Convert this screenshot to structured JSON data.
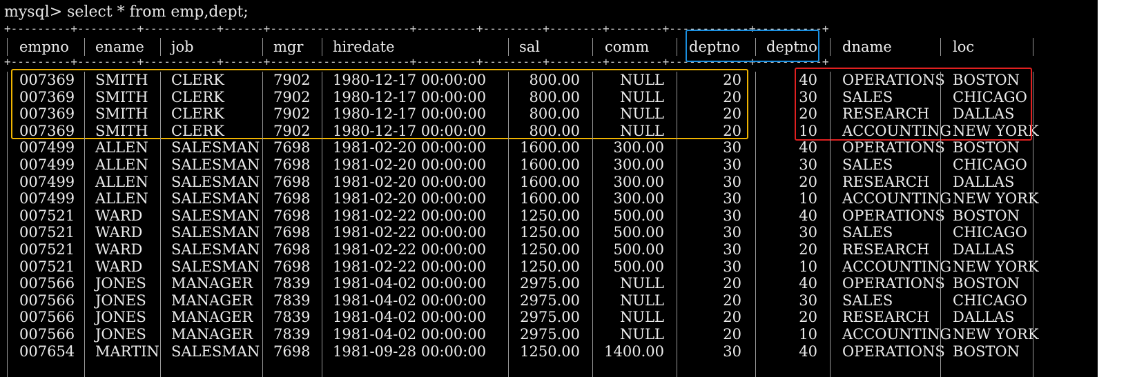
{
  "terminal": {
    "command_line": "mysql> select * from emp,dept;",
    "separator_line": "+---------+---------+-----------+------+---------------------+---------+---------+--------+--------+------------+----------+"
  },
  "table": {
    "columns": [
      "empno",
      "ename",
      "job",
      "mgr",
      "hiredate",
      "sal",
      "comm",
      "deptno",
      "deptno",
      "dname",
      "loc"
    ],
    "rows": [
      [
        "007369",
        "SMITH",
        "CLERK",
        "7902",
        "1980-12-17 00:00:00",
        "800.00",
        "NULL",
        "20",
        "40",
        "OPERATIONS",
        "BOSTON"
      ],
      [
        "007369",
        "SMITH",
        "CLERK",
        "7902",
        "1980-12-17 00:00:00",
        "800.00",
        "NULL",
        "20",
        "30",
        "SALES",
        "CHICAGO"
      ],
      [
        "007369",
        "SMITH",
        "CLERK",
        "7902",
        "1980-12-17 00:00:00",
        "800.00",
        "NULL",
        "20",
        "20",
        "RESEARCH",
        "DALLAS"
      ],
      [
        "007369",
        "SMITH",
        "CLERK",
        "7902",
        "1980-12-17 00:00:00",
        "800.00",
        "NULL",
        "20",
        "10",
        "ACCOUNTING",
        "NEW YORK"
      ],
      [
        "007499",
        "ALLEN",
        "SALESMAN",
        "7698",
        "1981-02-20 00:00:00",
        "1600.00",
        "300.00",
        "30",
        "40",
        "OPERATIONS",
        "BOSTON"
      ],
      [
        "007499",
        "ALLEN",
        "SALESMAN",
        "7698",
        "1981-02-20 00:00:00",
        "1600.00",
        "300.00",
        "30",
        "30",
        "SALES",
        "CHICAGO"
      ],
      [
        "007499",
        "ALLEN",
        "SALESMAN",
        "7698",
        "1981-02-20 00:00:00",
        "1600.00",
        "300.00",
        "30",
        "20",
        "RESEARCH",
        "DALLAS"
      ],
      [
        "007499",
        "ALLEN",
        "SALESMAN",
        "7698",
        "1981-02-20 00:00:00",
        "1600.00",
        "300.00",
        "30",
        "10",
        "ACCOUNTING",
        "NEW YORK"
      ],
      [
        "007521",
        "WARD",
        "SALESMAN",
        "7698",
        "1981-02-22 00:00:00",
        "1250.00",
        "500.00",
        "30",
        "40",
        "OPERATIONS",
        "BOSTON"
      ],
      [
        "007521",
        "WARD",
        "SALESMAN",
        "7698",
        "1981-02-22 00:00:00",
        "1250.00",
        "500.00",
        "30",
        "30",
        "SALES",
        "CHICAGO"
      ],
      [
        "007521",
        "WARD",
        "SALESMAN",
        "7698",
        "1981-02-22 00:00:00",
        "1250.00",
        "500.00",
        "30",
        "20",
        "RESEARCH",
        "DALLAS"
      ],
      [
        "007521",
        "WARD",
        "SALESMAN",
        "7698",
        "1981-02-22 00:00:00",
        "1250.00",
        "500.00",
        "30",
        "10",
        "ACCOUNTING",
        "NEW YORK"
      ],
      [
        "007566",
        "JONES",
        "MANAGER",
        "7839",
        "1981-04-02 00:00:00",
        "2975.00",
        "NULL",
        "20",
        "40",
        "OPERATIONS",
        "BOSTON"
      ],
      [
        "007566",
        "JONES",
        "MANAGER",
        "7839",
        "1981-04-02 00:00:00",
        "2975.00",
        "NULL",
        "20",
        "30",
        "SALES",
        "CHICAGO"
      ],
      [
        "007566",
        "JONES",
        "MANAGER",
        "7839",
        "1981-04-02 00:00:00",
        "2975.00",
        "NULL",
        "20",
        "20",
        "RESEARCH",
        "DALLAS"
      ],
      [
        "007566",
        "JONES",
        "MANAGER",
        "7839",
        "1981-04-02 00:00:00",
        "2975.00",
        "NULL",
        "20",
        "10",
        "ACCOUNTING",
        "NEW YORK"
      ],
      [
        "007654",
        "MARTIN",
        "SALESMAN",
        "7698",
        "1981-09-28 00:00:00",
        "1250.00",
        "1400.00",
        "30",
        "40",
        "OPERATIONS",
        "BOSTON"
      ]
    ]
  },
  "highlights": {
    "yellow_color": "#f0b400",
    "blue_color": "#1a8fe0",
    "red_color": "#e02020"
  }
}
